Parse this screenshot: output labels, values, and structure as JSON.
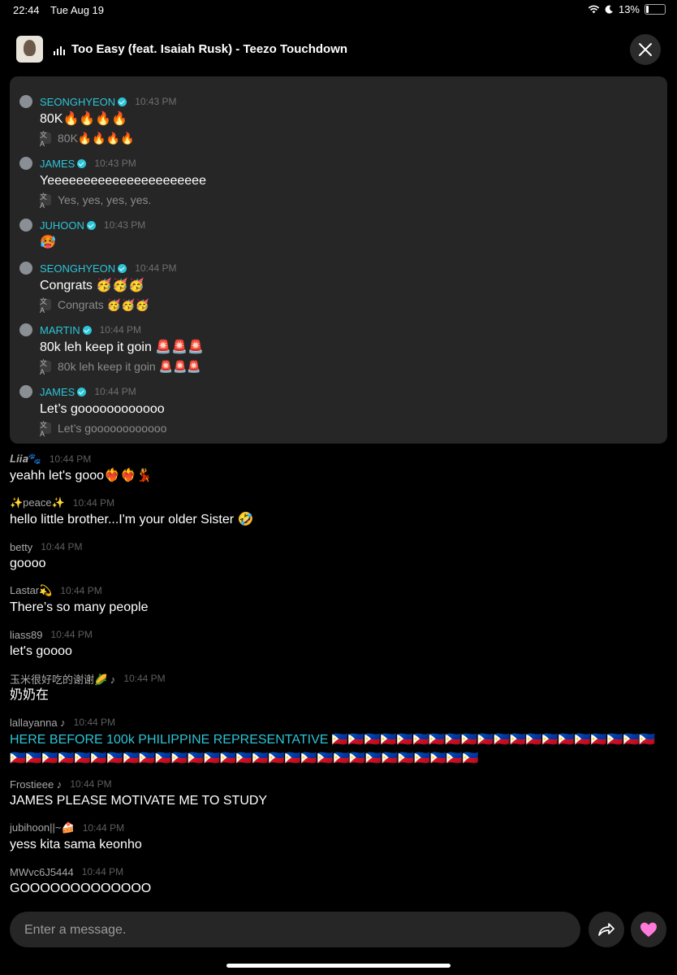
{
  "status_bar": {
    "time": "22:44",
    "date": "Tue Aug 19",
    "battery": "13%"
  },
  "header": {
    "song_title": "Too Easy (feat. Isaiah Rusk) - Teezo Touchdown"
  },
  "pinned_messages": [
    {
      "user": "SEONGHYEON",
      "time": "10:43 PM",
      "text": "80K🔥🔥🔥🔥",
      "translation": "80K🔥🔥🔥🔥"
    },
    {
      "user": "JAMES",
      "time": "10:43 PM",
      "text": "Yeeeeeeeeeeeeeeeeeeeeee",
      "translation": "Yes, yes, yes, yes."
    },
    {
      "user": "JUHOON",
      "time": "10:43 PM",
      "text": "🥵",
      "translation": ""
    },
    {
      "user": "SEONGHYEON",
      "time": "10:44 PM",
      "text": "Congrats 🥳🥳🥳",
      "translation": "Congrats 🥳🥳🥳"
    },
    {
      "user": "MARTIN",
      "time": "10:44 PM",
      "text": "80k leh keep it goin 🚨🚨🚨",
      "translation": "80k leh keep it goin 🚨🚨🚨"
    },
    {
      "user": "JAMES",
      "time": "10:44 PM",
      "text": "Let’s goooooooooooo",
      "translation": "Let’s goooooooooooo"
    }
  ],
  "chat_messages": [
    {
      "user": "𝑳𝒊𝒊𝒂🐾",
      "time": "10:44 PM",
      "text": "yeahh let's gooo❤️‍🔥❤️‍🔥💃"
    },
    {
      "user": "✨peace✨",
      "time": "10:44 PM",
      "text": "hello little brother...I'm your older Sister 🤣"
    },
    {
      "user": "betty",
      "time": "10:44 PM",
      "text": "goooo"
    },
    {
      "user": "Lastar💫",
      "time": "10:44 PM",
      "text": "There’s so many people"
    },
    {
      "user": "liass89",
      "time": "10:44 PM",
      "text": "let's goooo"
    },
    {
      "user": "玉米很好吃的谢谢🌽 ♪",
      "time": "10:44 PM",
      "text": "奶奶在"
    },
    {
      "user": "lallayanna ♪",
      "time": "10:44 PM",
      "text": "HERE BEFORE 100k PHILIPPINE REPRESENTATIVE 🇵🇭🇵🇭🇵🇭🇵🇭🇵🇭🇵🇭🇵🇭🇵🇭🇵🇭🇵🇭🇵🇭🇵🇭🇵🇭🇵🇭🇵🇭🇵🇭🇵🇭🇵🇭🇵🇭🇵🇭🇵🇭🇵🇭🇵🇭🇵🇭🇵🇭🇵🇭🇵🇭🇵🇭🇵🇭🇵🇭🇵🇭🇵🇭🇵🇭🇵🇭🇵🇭🇵🇭🇵🇭🇵🇭🇵🇭🇵🇭🇵🇭🇵🇭🇵🇭🇵🇭🇵🇭🇵🇭🇵🇭🇵🇭🇵🇭"
    },
    {
      "user": "Frostieee ♪",
      "time": "10:44 PM",
      "text": "JAMES PLEASE MOTIVATE ME TO STUDY"
    },
    {
      "user": "jubihoon||~🍰",
      "time": "10:44 PM",
      "text": "yess kita sama keonho"
    },
    {
      "user": "MWvc6J5444",
      "time": "10:44 PM",
      "text": "GOOOOOOOOOOOOO"
    }
  ],
  "composer": {
    "placeholder": "Enter a message."
  },
  "icons": {
    "share": "share-arrow-icon",
    "like": "heart-icon",
    "close": "close-icon",
    "translate": "translate-icon",
    "verified": "verified-badge-icon"
  },
  "colors": {
    "accent": "#2bc5d8",
    "heart": "#ff7ad9",
    "panel": "#262626"
  }
}
